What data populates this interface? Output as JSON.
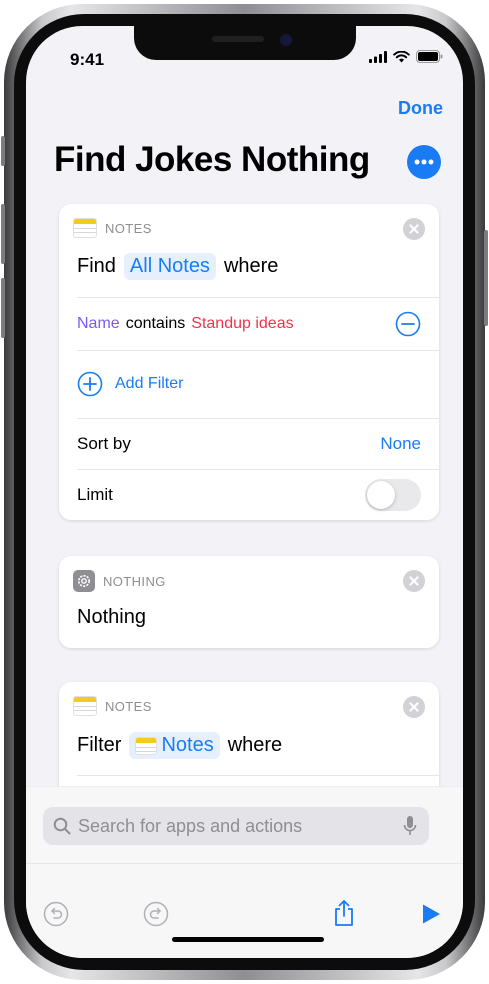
{
  "status": {
    "time": "9:41"
  },
  "header": {
    "done_label": "Done",
    "title": "Find Jokes Nothing"
  },
  "card1": {
    "app_label": "NOTES",
    "verb": "Find",
    "token": "All Notes",
    "suffix": "where",
    "filter": {
      "field": "Name",
      "op": "contains",
      "value": "Standup ideas"
    },
    "add_filter_label": "Add Filter",
    "sort_label": "Sort by",
    "sort_value": "None",
    "limit_label": "Limit"
  },
  "card2": {
    "app_label": "NOTHING",
    "title": "Nothing"
  },
  "card3": {
    "app_label": "NOTES",
    "verb": "Filter",
    "token": "Notes",
    "suffix": "where"
  },
  "search": {
    "placeholder": "Search for apps and actions"
  },
  "colors": {
    "accent": "#1a7cf5",
    "field_purple": "#7a5af5",
    "value_red": "#f0334b"
  }
}
